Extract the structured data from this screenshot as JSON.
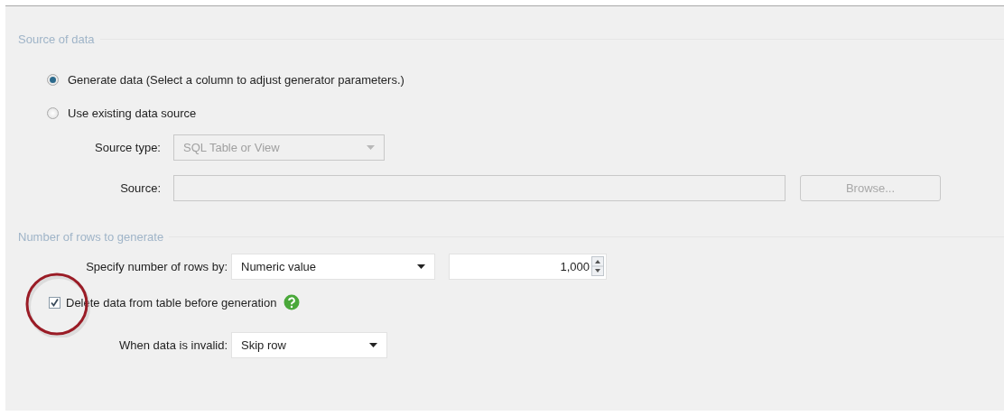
{
  "source_section": {
    "title": "Source of data",
    "options": [
      {
        "label": "Generate data (Select a column to adjust generator parameters.)",
        "selected": true
      },
      {
        "label": "Use existing data source",
        "selected": false
      }
    ],
    "source_type": {
      "label": "Source type:",
      "value": "SQL Table or View",
      "disabled": true
    },
    "source": {
      "label": "Source:",
      "disabled": true
    },
    "browse_button": {
      "label": "Browse...",
      "disabled": true
    }
  },
  "rows_section": {
    "title": "Number of rows to generate",
    "specify": {
      "label": "Specify number of rows by:",
      "value": "Numeric value"
    },
    "count": {
      "value": "1,000"
    },
    "delete_checkbox": {
      "label": "Delete data from table before generation",
      "checked": true
    },
    "invalid": {
      "label": "When data is invalid:",
      "value": "Skip row"
    }
  }
}
